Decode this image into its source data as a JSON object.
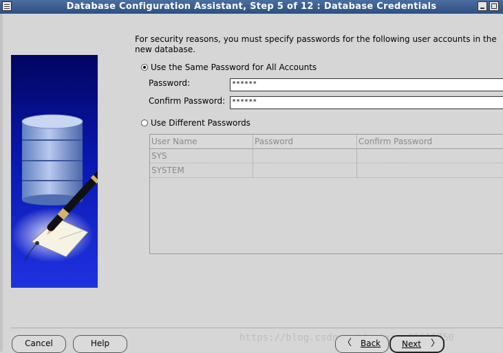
{
  "window": {
    "title": "Database Configuration Assistant, Step 5 of 12 : Database Credentials"
  },
  "intro": "For security reasons, you must specify passwords for the following user accounts in the new database.",
  "same_password": {
    "label": "Use the Same Password for All Accounts",
    "selected": true,
    "password_label": "Password:",
    "password_value": "******",
    "confirm_label": "Confirm Password:",
    "confirm_value": "******"
  },
  "different_passwords": {
    "label": "Use Different Passwords",
    "selected": false,
    "columns": [
      "User Name",
      "Password",
      "Confirm Password"
    ],
    "rows": [
      [
        "SYS",
        "",
        ""
      ],
      [
        "SYSTEM",
        "",
        ""
      ]
    ]
  },
  "buttons": {
    "cancel": "Cancel",
    "help": "Help",
    "back": "Back",
    "next": "Next"
  },
  "watermark": "https://blog.csdn.net/weixin_39619750",
  "colors": {
    "titlebar": "#2f5081",
    "panel": "#0918b0",
    "background": "#d6d6d6"
  }
}
